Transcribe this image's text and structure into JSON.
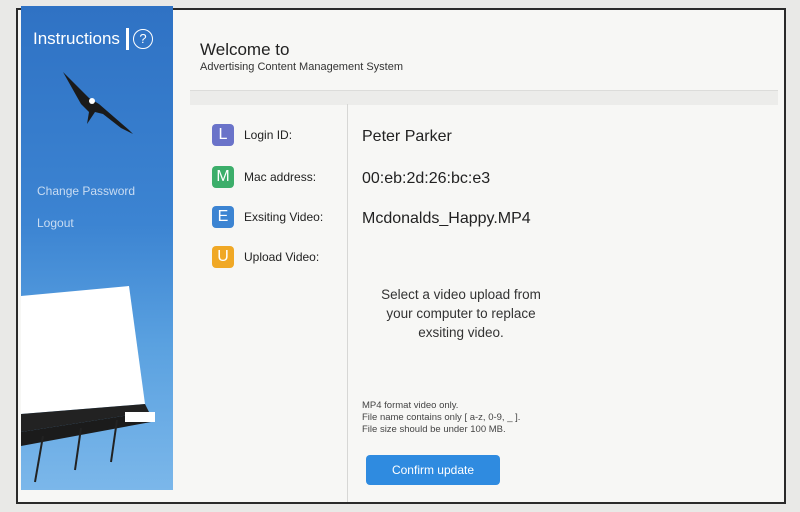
{
  "sidebar": {
    "instructions_label": "Instructions",
    "help_icon": "?",
    "links": {
      "change_password": "Change Password",
      "logout": "Logout"
    }
  },
  "header": {
    "title": "Welcome to",
    "subtitle": "Advertising Content Management System"
  },
  "form": {
    "rows": [
      {
        "letter": "L",
        "label": "Login ID:",
        "value": "Peter Parker",
        "color": "#6a73c9"
      },
      {
        "letter": "M",
        "label": "Mac address:",
        "value": "00:eb:2d:26:bc:e3",
        "color": "#3cae6a"
      },
      {
        "letter": "E",
        "label": "Exsiting Video:",
        "value": "Mcdonalds_Happy.MP4",
        "color": "#3c84d2"
      },
      {
        "letter": "U",
        "label": "Upload Video:",
        "value": "",
        "color": "#f0a825"
      }
    ],
    "upload_hint": "Select a video upload from your computer to replace exsiting video.",
    "rules": [
      "MP4 format video only.",
      "File name contains only [ a-z, 0-9, _ ].",
      "File size should be under 100 MB."
    ],
    "confirm_label": "Confirm update"
  }
}
